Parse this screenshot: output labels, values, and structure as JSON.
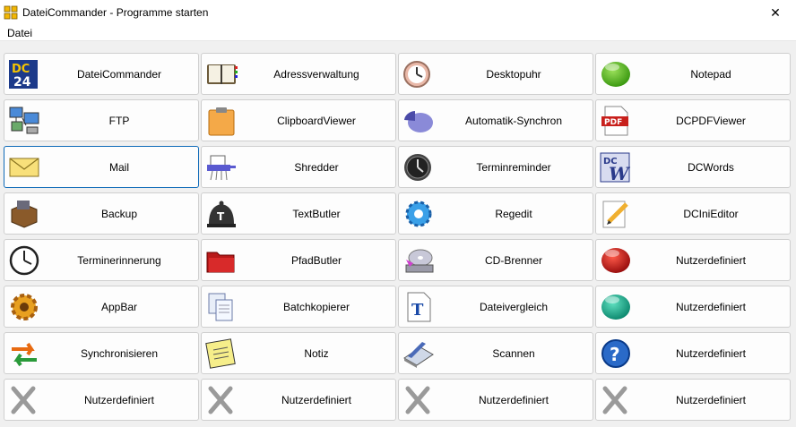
{
  "window": {
    "title": "DateiCommander - Programme starten",
    "close_symbol": "✕",
    "app_icon": "four-squares-icon"
  },
  "menu": {
    "items": [
      {
        "label": "Datei"
      }
    ]
  },
  "colors": {
    "accent_focus": "#0e6ab8",
    "grid_background": "#f0f0f0"
  },
  "buttons": [
    {
      "label": "DateiCommander",
      "icon": "dc24-logo-icon",
      "icon_text": [
        "DC",
        "24"
      ]
    },
    {
      "label": "Adressverwaltung",
      "icon": "address-book-icon"
    },
    {
      "label": "Desktopuhr",
      "icon": "desk-clock-icon"
    },
    {
      "label": "Notepad",
      "icon": "green-ball-icon"
    },
    {
      "label": "FTP",
      "icon": "network-computers-icon"
    },
    {
      "label": "ClipboardViewer",
      "icon": "clipboard-icon"
    },
    {
      "label": "Automatik-Synchron",
      "icon": "pie-chart-icon"
    },
    {
      "label": "DCPDFViewer",
      "icon": "pdf-document-icon",
      "icon_text": [
        "PDF"
      ]
    },
    {
      "label": "Mail",
      "icon": "envelope-icon",
      "focused": true
    },
    {
      "label": "Shredder",
      "icon": "shredder-icon"
    },
    {
      "label": "Terminreminder",
      "icon": "dark-clock-icon"
    },
    {
      "label": "DCWords",
      "icon": "dcwords-logo-icon",
      "icon_text": [
        "DC",
        "W"
      ]
    },
    {
      "label": "Backup",
      "icon": "backup-box-icon"
    },
    {
      "label": "TextButler",
      "icon": "butler-bell-icon",
      "icon_text": [
        "T"
      ]
    },
    {
      "label": "Regedit",
      "icon": "blue-gear-icon"
    },
    {
      "label": "DCIniEditor",
      "icon": "note-pencil-icon"
    },
    {
      "label": "Terminerinnerung",
      "icon": "wall-clock-icon"
    },
    {
      "label": "PfadButler",
      "icon": "red-folder-icon"
    },
    {
      "label": "CD-Brenner",
      "icon": "cd-drive-icon"
    },
    {
      "label": "Nutzerdefiniert",
      "icon": "red-ball-icon"
    },
    {
      "label": "AppBar",
      "icon": "orange-gear-icon"
    },
    {
      "label": "Batchkopierer",
      "icon": "copy-documents-icon"
    },
    {
      "label": "Dateivergleich",
      "icon": "text-document-icon",
      "icon_text": [
        "T"
      ]
    },
    {
      "label": "Nutzerdefiniert",
      "icon": "teal-ball-icon"
    },
    {
      "label": "Synchronisieren",
      "icon": "sync-arrows-icon"
    },
    {
      "label": "Notiz",
      "icon": "sticky-note-icon"
    },
    {
      "label": "Scannen",
      "icon": "scanner-icon"
    },
    {
      "label": "Nutzerdefiniert",
      "icon": "question-mark-icon",
      "icon_text": [
        "?"
      ]
    },
    {
      "label": "Nutzerdefiniert",
      "icon": "gray-x-icon"
    },
    {
      "label": "Nutzerdefiniert",
      "icon": "gray-x-icon"
    },
    {
      "label": "Nutzerdefiniert",
      "icon": "gray-x-icon"
    },
    {
      "label": "Nutzerdefiniert",
      "icon": "gray-x-icon"
    }
  ]
}
